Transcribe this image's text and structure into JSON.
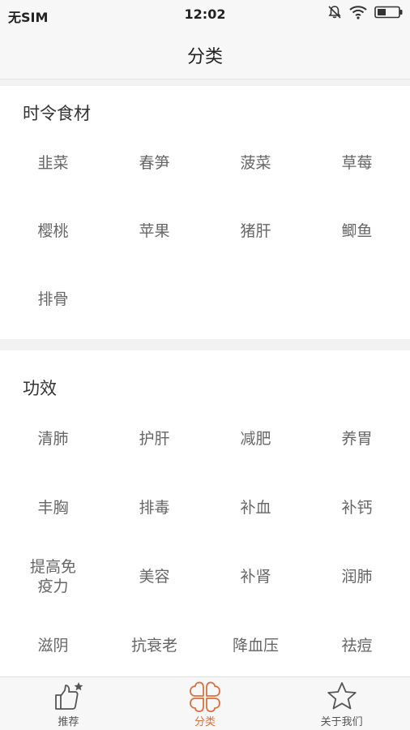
{
  "status_bar": {
    "carrier": "无SIM",
    "time": "12:02",
    "icons": [
      "mute-bell-icon",
      "wifi-icon",
      "battery-icon"
    ]
  },
  "nav": {
    "title": "分类"
  },
  "sections": [
    {
      "title": "时令食材",
      "items": [
        "韭菜",
        "春笋",
        "菠菜",
        "草莓",
        "樱桃",
        "苹果",
        "猪肝",
        "鲫鱼",
        "排骨"
      ]
    },
    {
      "title": "功效",
      "items": [
        "清肺",
        "护肝",
        "减肥",
        "养胃",
        "丰胸",
        "排毒",
        "补血",
        "补钙",
        "提高免疫力",
        "美容",
        "补肾",
        "润肺",
        "滋阴",
        "抗衰老",
        "降血压",
        "祛痘"
      ]
    }
  ],
  "tabs": [
    {
      "label": "推荐",
      "icon": "thumbs-up-icon",
      "active": false
    },
    {
      "label": "分类",
      "icon": "clover-grid-icon",
      "active": true
    },
    {
      "label": "关于我们",
      "icon": "star-icon",
      "active": false
    }
  ],
  "colors": {
    "accent": "#d8703f",
    "background": "#f2f2f2",
    "item_text": "#666666"
  }
}
